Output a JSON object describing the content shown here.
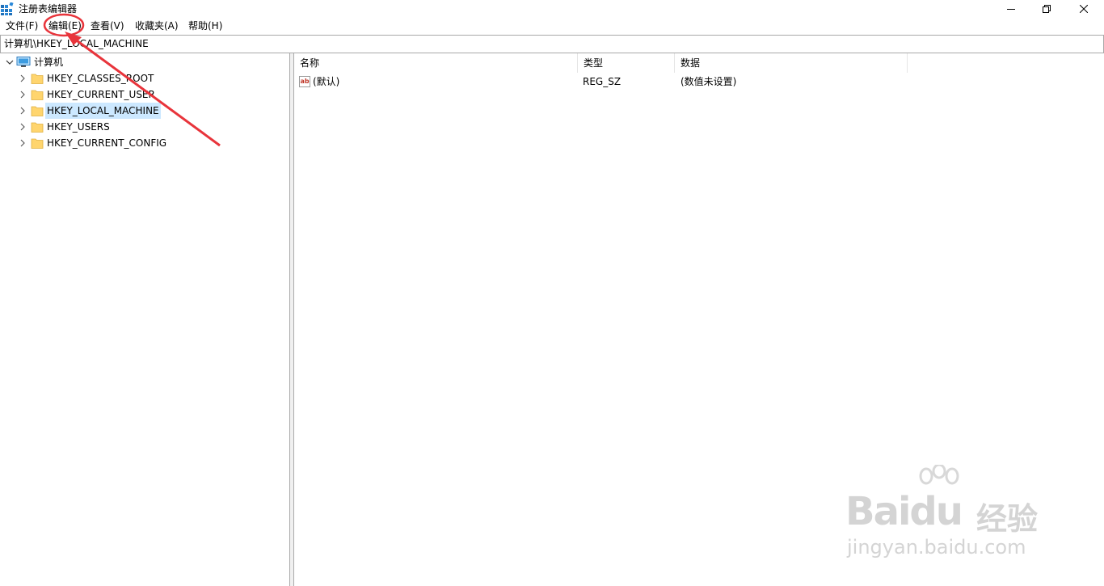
{
  "window": {
    "title": "注册表编辑器",
    "icon": "registry-editor-icon"
  },
  "menu": [
    {
      "label": "文件(F)"
    },
    {
      "label": "编辑(E)"
    },
    {
      "label": "查看(V)"
    },
    {
      "label": "收藏夹(A)"
    },
    {
      "label": "帮助(H)"
    }
  ],
  "address": {
    "path": "计算机\\HKEY_LOCAL_MACHINE"
  },
  "tree": {
    "root": "计算机",
    "items": [
      {
        "label": "HKEY_CLASSES_ROOT"
      },
      {
        "label": "HKEY_CURRENT_USER"
      },
      {
        "label": "HKEY_LOCAL_MACHINE"
      },
      {
        "label": "HKEY_USERS"
      },
      {
        "label": "HKEY_CURRENT_CONFIG"
      }
    ],
    "selected": "HKEY_LOCAL_MACHINE"
  },
  "list": {
    "columns": [
      "名称",
      "类型",
      "数据"
    ],
    "rows": [
      {
        "name": "(默认)",
        "type": "REG_SZ",
        "data": "(数值未设置)"
      }
    ]
  },
  "colors": {
    "selection": "#cce8ff",
    "annotation": "#e8343b",
    "folder": "#ffd56e"
  },
  "watermark": {
    "brand": "Baidu",
    "suffix": "经验",
    "url": "jingyan.baidu.com"
  }
}
